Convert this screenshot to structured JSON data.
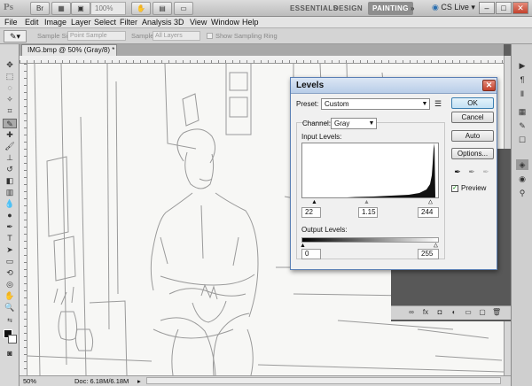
{
  "app": {
    "logo": "Ps",
    "zoom": "100%",
    "workspaces": [
      "ESSENTIALS",
      "DESIGN",
      "PAINTING"
    ],
    "active_workspace": "PAINTING",
    "workspace_more": "»",
    "cs_live": "CS Live",
    "window_buttons": [
      "–",
      "□",
      "✕"
    ]
  },
  "menu": [
    "File",
    "Edit",
    "Image",
    "Layer",
    "Select",
    "Filter",
    "Analysis",
    "3D",
    "View",
    "Window",
    "Help"
  ],
  "options": {
    "sample_size_label": "Sample Size:",
    "sample_size_value": "Point Sample",
    "sample_label": "Sample:",
    "sample_value": "All Layers",
    "show_ring_label": "Show Sampling Ring"
  },
  "document": {
    "tab_title": "IMG.bmp @ 50% (Gray/8) *",
    "tab_close": "×",
    "status_zoom": "50%",
    "status_doc": "Doc: 6.18M/6.18M"
  },
  "levels": {
    "title": "Levels",
    "close": "✕",
    "preset_label": "Preset:",
    "preset_value": "Custom",
    "channel_label": "Channel:",
    "channel_value": "Gray",
    "input_levels_label": "Input Levels:",
    "input_black": "22",
    "input_gamma": "1.15",
    "input_white": "244",
    "output_levels_label": "Output Levels:",
    "output_black": "0",
    "output_white": "255",
    "buttons": {
      "ok": "OK",
      "cancel": "Cancel",
      "auto": "Auto",
      "options": "Options..."
    },
    "preview_label": "Preview",
    "preview_checked": true
  },
  "colors": {
    "chrome_light": "#dcdcdc",
    "dialog_title": "#b8cde8",
    "close_red": "#c2412c"
  }
}
